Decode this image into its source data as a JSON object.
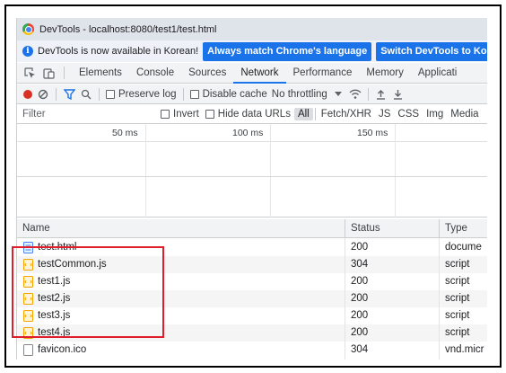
{
  "window": {
    "title": "DevTools - localhost:8080/test1/test.html"
  },
  "infobar": {
    "message": "DevTools is now available in Korean!",
    "match_language_button": "Always match Chrome's language",
    "switch_button": "Switch DevTools to Korea"
  },
  "tabs": [
    {
      "label": "Elements"
    },
    {
      "label": "Console"
    },
    {
      "label": "Sources"
    },
    {
      "label": "Network"
    },
    {
      "label": "Performance"
    },
    {
      "label": "Memory"
    },
    {
      "label": "Applicati"
    }
  ],
  "active_tab": "Network",
  "toolbar": {
    "preserve_log": "Preserve log",
    "disable_cache": "Disable cache",
    "throttling": "No throttling"
  },
  "filter": {
    "placeholder": "Filter",
    "invert": "Invert",
    "hide_data_urls": "Hide data URLs",
    "types": [
      "All",
      "Fetch/XHR",
      "JS",
      "CSS",
      "Img",
      "Media"
    ]
  },
  "timeline": {
    "labels": [
      "50 ms",
      "100 ms",
      "150 ms"
    ]
  },
  "table": {
    "headers": {
      "name": "Name",
      "status": "Status",
      "type": "Type"
    },
    "rows": [
      {
        "name": "test.html",
        "status": "200",
        "type": "docume",
        "icon": "document-icon"
      },
      {
        "name": "testCommon.js",
        "status": "304",
        "type": "script",
        "icon": "script-file-icon"
      },
      {
        "name": "test1.js",
        "status": "200",
        "type": "script",
        "icon": "script-file-icon"
      },
      {
        "name": "test2.js",
        "status": "200",
        "type": "script",
        "icon": "script-file-icon"
      },
      {
        "name": "test3.js",
        "status": "200",
        "type": "script",
        "icon": "script-file-icon"
      },
      {
        "name": "test4.js",
        "status": "200",
        "type": "script",
        "icon": "script-file-icon"
      },
      {
        "name": "favicon.ico",
        "status": "304",
        "type": "vnd.micr",
        "icon": "blank-file-icon"
      }
    ]
  },
  "colors": {
    "accent": "#1a73e8",
    "record": "#d93025",
    "highlight": "#e01e2b",
    "script_icon": "#f4a300",
    "document_icon": "#4285f4"
  }
}
